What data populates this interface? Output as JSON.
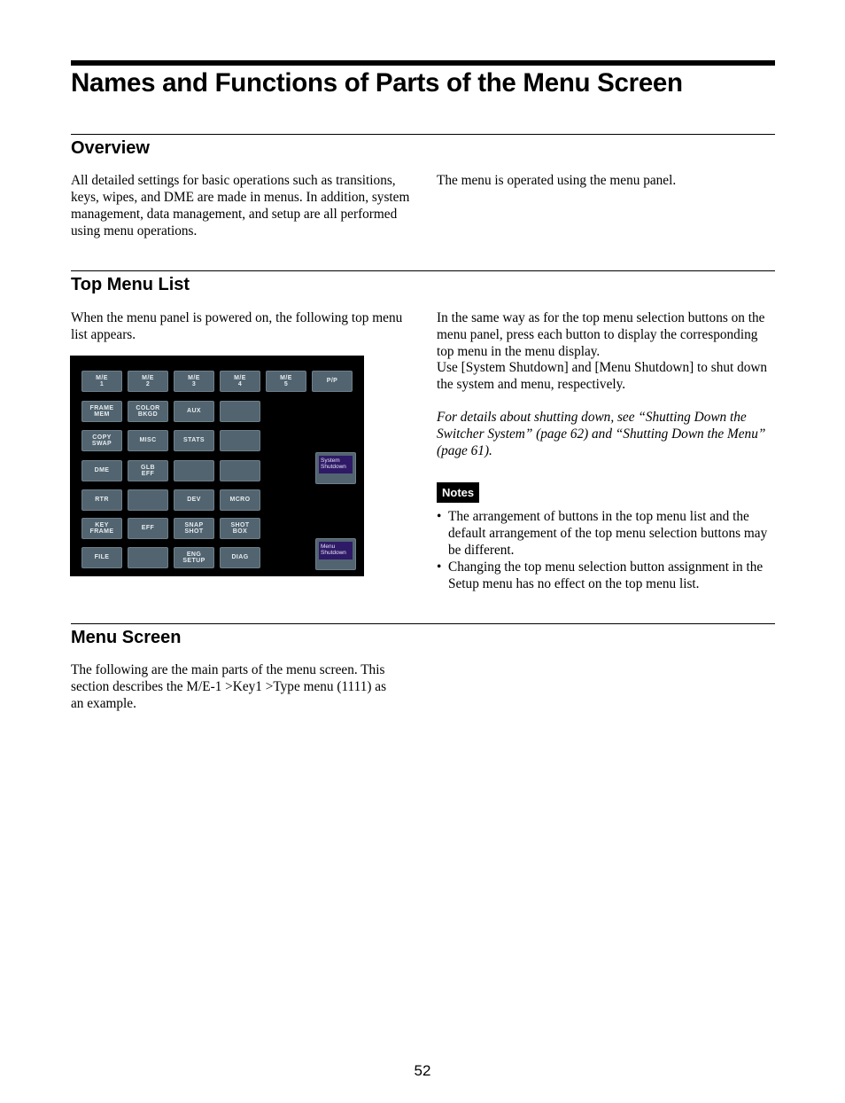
{
  "page_title": "Names and Functions of Parts of the Menu Screen",
  "sections": {
    "overview": {
      "heading": "Overview",
      "left_text": "All detailed settings for basic operations such as transitions, keys, wipes, and DME are made in menus. In addition, system management, data management, and setup are all performed using menu operations.",
      "right_text": "The menu is operated using the menu panel."
    },
    "top_menu_list": {
      "heading": "Top Menu List",
      "left_text": "When the menu panel is powered on, the following top menu list appears.",
      "right_text_1": "In the same way as for the top menu selection buttons on the menu panel, press each button to display the corresponding top menu in the menu display.",
      "right_text_2": "Use [System Shutdown] and [Menu Shutdown] to shut down the system and menu, respectively.",
      "italic_ref": "For details about shutting down, see “Shutting Down the Switcher System” (page 62) and “Shutting Down the Menu” (page 61).",
      "notes_label": "Notes",
      "notes": [
        "The arrangement of buttons in the top menu list and the default arrangement of the top menu selection buttons may be different.",
        "Changing the top menu selection button assignment in the Setup menu has no effect on the top menu list."
      ],
      "panel": {
        "rows": [
          [
            "M/E\n1",
            "M/E\n2",
            "M/E\n3",
            "M/E\n4",
            "M/E\n5",
            "P/P"
          ],
          [
            "FRAME\nMEM",
            "COLOR\nBKGD",
            "AUX",
            ""
          ],
          [
            "COPY\nSWAP",
            "MISC",
            "STATS",
            ""
          ],
          [
            "DME",
            "GLB\nEFF",
            "",
            ""
          ],
          [
            "RTR",
            "",
            "DEV",
            "MCRO"
          ],
          [
            "KEY\nFRAME",
            "EFF",
            "SNAP\nSHOT",
            "SHOT\nBOX"
          ],
          [
            "FILE",
            "",
            "ENG\nSETUP",
            "DIAG"
          ]
        ],
        "system_shutdown": "System\nShutdown",
        "menu_shutdown": "Menu\nShutdown",
        "colors": {
          "background": "#000000",
          "button": "#526470",
          "shutdown_inner": "#2e1a66"
        }
      }
    },
    "menu_screen": {
      "heading": "Menu Screen",
      "text": "The following are the main parts of the menu screen. This section describes the M/E-1 >Key1 >Type menu (1111) as an example."
    }
  },
  "page_number": "52"
}
